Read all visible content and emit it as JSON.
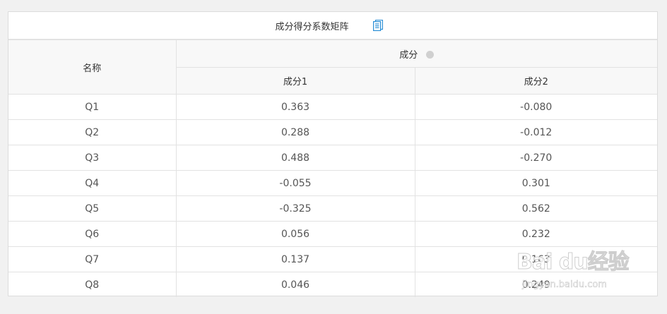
{
  "table": {
    "title": "成分得分系数矩阵",
    "name_header": "名称",
    "group_header": "成分",
    "columns": [
      "成分1",
      "成分2"
    ],
    "rows": [
      {
        "name": "Q1",
        "c1": "0.363",
        "c2": "-0.080"
      },
      {
        "name": "Q2",
        "c1": "0.288",
        "c2": "-0.012"
      },
      {
        "name": "Q3",
        "c1": "0.488",
        "c2": "-0.270"
      },
      {
        "name": "Q4",
        "c1": "-0.055",
        "c2": "0.301"
      },
      {
        "name": "Q5",
        "c1": "-0.325",
        "c2": "0.562"
      },
      {
        "name": "Q6",
        "c1": "0.056",
        "c2": "0.232"
      },
      {
        "name": "Q7",
        "c1": "0.137",
        "c2": "0.163"
      },
      {
        "name": "Q8",
        "c1": "0.046",
        "c2": "0.249"
      }
    ]
  },
  "icons": {
    "copy": "copy-icon",
    "help": "help-icon"
  },
  "colors": {
    "accent": "#2b8fd6",
    "header_bg": "#f8f8f8",
    "border": "#e2e2e2"
  },
  "watermark": {
    "brand": "Bai du经验",
    "url": "jingyan.baidu.com"
  }
}
